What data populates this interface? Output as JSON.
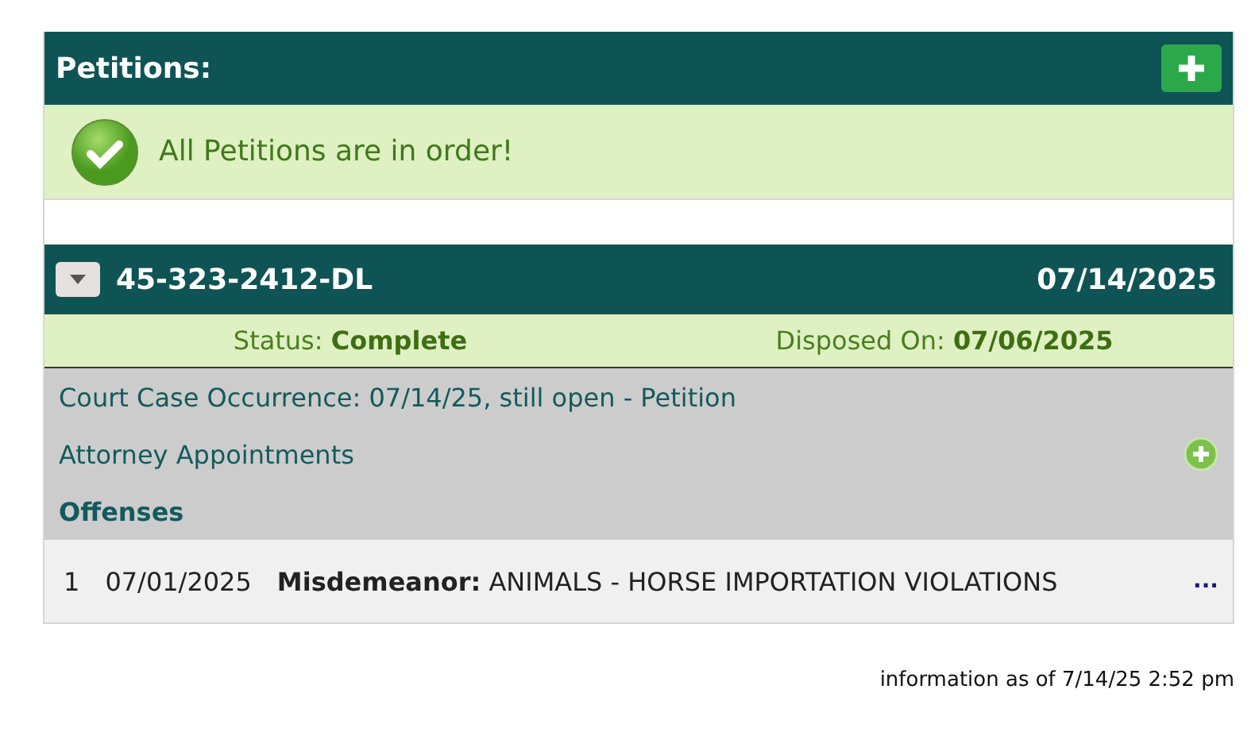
{
  "petitions": {
    "title": "Petitions:",
    "message": "All Petitions are in order!"
  },
  "case": {
    "number": "45-323-2412-DL",
    "date": "07/14/2025",
    "status": "Status: **Complete**",
    "disposed": "Disposed On: **07/06/2025**",
    "occurrence": "Court Case Occurrence: 07/14/25, still open - Petition",
    "attorney": "Attorney Appointments",
    "offenses_heading": "Offenses",
    "offenses": [
      {
        "index": "1",
        "date": "07/01/2025",
        "description": "**Misdemeanor:** ANIMALS - HORSE IMPORTATION VIOLATIONS",
        "more": "..."
      }
    ]
  },
  "footer": "information as of 7/14/25 2:52 pm"
}
